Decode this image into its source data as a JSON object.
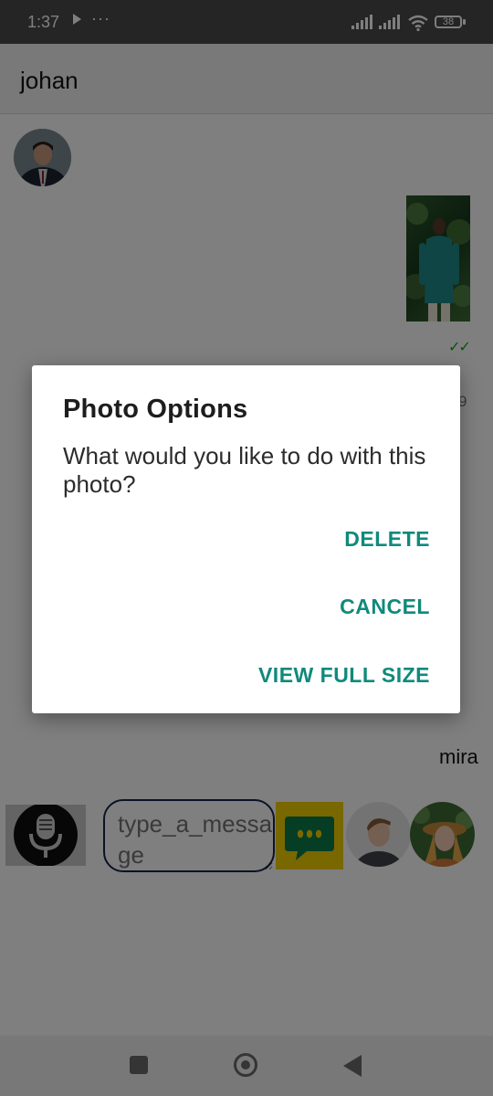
{
  "status_bar": {
    "time": "1:37",
    "more_indicator": "···",
    "battery_level": "38",
    "icons": [
      "play-icon",
      "signal-icon",
      "signal-icon",
      "wifi-icon",
      "battery-icon"
    ]
  },
  "chat": {
    "title": "johan",
    "read_receipt": "✓✓",
    "peek_text": "9",
    "sender_name": "mira"
  },
  "input": {
    "placeholder": "type_a_message"
  },
  "dialog": {
    "title": "Photo Options",
    "message": "What would you like to do with this photo?",
    "actions": {
      "delete": "DELETE",
      "cancel": "CANCEL",
      "view_full_size": "VIEW FULL SIZE"
    }
  },
  "colors": {
    "status_bar": "#4a4a4a",
    "accent": "#0f8a7c",
    "read_tick": "#18a318",
    "bubble_button": "#f3cf00",
    "input_border": "#16254a"
  }
}
